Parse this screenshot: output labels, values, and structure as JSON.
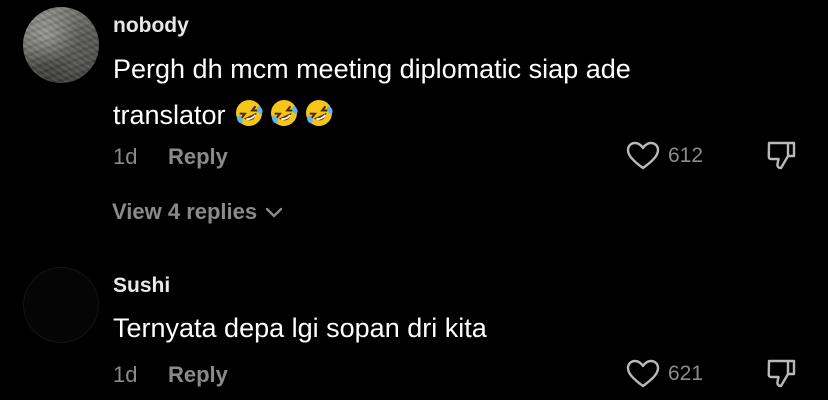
{
  "comments": [
    {
      "username": "nobody",
      "text_line1": "Pergh dh mcm meeting diplomatic siap ade",
      "text_line2": "translator",
      "emojis": [
        "rolling-on-floor-laughing-emoji",
        "rolling-on-floor-laughing-emoji",
        "rolling-on-floor-laughing-emoji"
      ],
      "time": "1d",
      "reply_label": "Reply",
      "like_count": "612",
      "view_replies_label": "View 4 replies"
    },
    {
      "username": "Sushi",
      "text": "Ternyata depa lgi sopan dri kita",
      "time": "1d",
      "reply_label": "Reply",
      "like_count": "621"
    }
  ],
  "icons": {
    "like": "heart-outline-icon",
    "dislike": "thumbs-down-outline-icon",
    "expand": "chevron-down-icon"
  },
  "colors": {
    "background": "#000000",
    "text": "#ffffff",
    "muted": "#8a8a8a",
    "emoji": "#f5c518"
  }
}
